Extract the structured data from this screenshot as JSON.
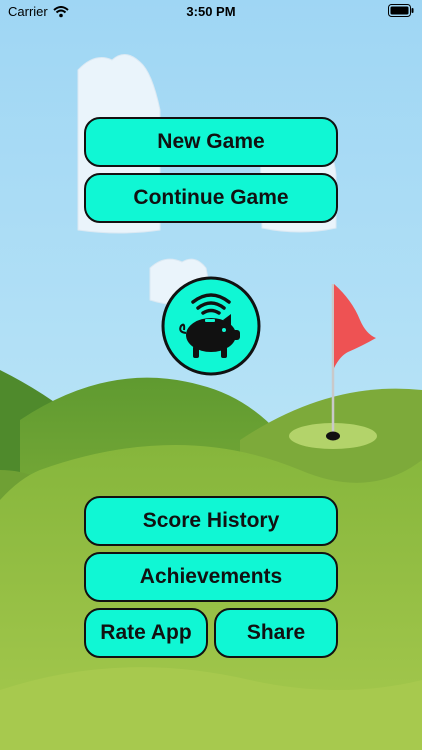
{
  "status_bar": {
    "carrier": "Carrier",
    "time": "3:50 PM"
  },
  "menu": {
    "new_game": "New Game",
    "continue_game": "Continue Game",
    "score_history": "Score History",
    "achievements": "Achievements",
    "rate_app": "Rate App",
    "share": "Share"
  },
  "logo": {
    "icon": "piggy-bank-signal-icon"
  },
  "colors": {
    "sky": "#a9d9f5",
    "button": "#10f7d4",
    "flag": "#ef5350",
    "hill_dark": "#4e8a2d",
    "hill_light": "#8ab83f"
  }
}
